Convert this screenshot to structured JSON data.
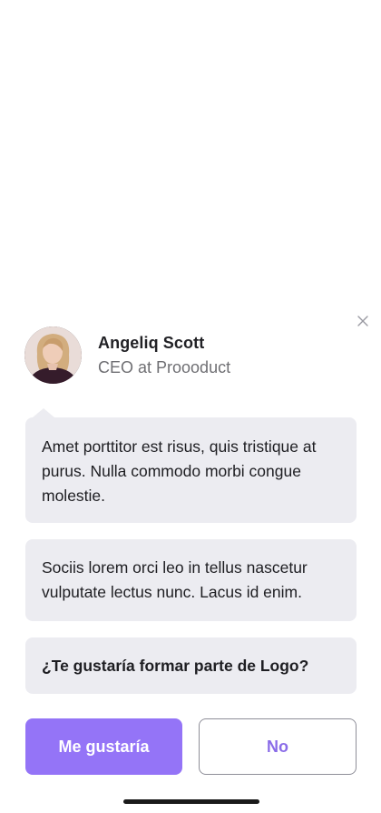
{
  "profile": {
    "name": "Angeliq Scott",
    "role": "CEO at Proooduct"
  },
  "messages": [
    "Amet porttitor est risus, quis tristique at purus. Nulla commodo morbi congue molestie.",
    "Sociis lorem orci leo in tellus nascetur vulputate lectus nunc. Lacus id enim.",
    "¿Te gustaría formar parte de Logo?"
  ],
  "actions": {
    "yes_label": "Me gustaría",
    "no_label": "No"
  },
  "icons": {
    "close": "close-icon",
    "avatar": "avatar-photo"
  },
  "colors": {
    "accent": "#9474f7",
    "bubble": "#ececf1"
  }
}
